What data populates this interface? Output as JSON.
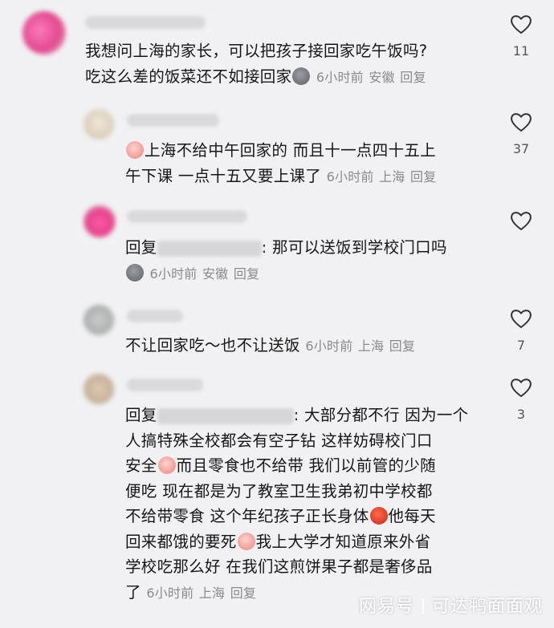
{
  "comments": [
    {
      "text": "我想问上海的家长，可以把孩子接回家吃午饭吗?",
      "text2": "吃这么差的饭菜还不如接回家",
      "emoji": "gray-face-emoji",
      "time": "6小时前",
      "location": "安徽",
      "reply": "回复",
      "likes": "11"
    },
    {
      "text": "上海不给中午回家的 而且十一点四十五上",
      "text2": "午下课 一点十五又要上课了",
      "emoji": "crying-pink-emoji",
      "time": "6小时前",
      "location": "上海",
      "reply": "回复",
      "likes": "37"
    },
    {
      "prefix": "回复",
      "suffix": ": 那可以送饭到学校门口吗",
      "emoji": "gray-face-emoji",
      "time": "6小时前",
      "location": "安徽",
      "reply": "回复",
      "likes": ""
    },
    {
      "text": "不让回家吃～也不让送饭",
      "time": "6小时前",
      "location": "上海",
      "reply": "回复",
      "likes": "7"
    },
    {
      "prefix": "回复",
      "line1": ": 大部分都不行 因为一个",
      "line2": "人搞特殊全校都会有空子钻 这样妨碍校门口",
      "line3a": "安全",
      "line3b": "而且零食也不给带 我们以前管的少随",
      "line4": "便吃 现在都是为了教室卫生我弟初中学校都",
      "line5a": "不给带零食 这个年纪孩子正长身体",
      "line5b": "他每天",
      "line6a": "回来都饿的要死",
      "line6b": "我上大学才知道原来外省",
      "line7": "学校吃那么好 在我们这煎饼果子都是奢侈品",
      "line8": "了",
      "time": "6小时前",
      "location": "上海",
      "reply": "回复",
      "likes": "3"
    }
  ],
  "watermark": {
    "platform": "网易号",
    "author": "可达鸭面面观"
  },
  "colors": {
    "background": "#f1f1f3",
    "meta": "#8a8a8e",
    "text": "#161616"
  }
}
